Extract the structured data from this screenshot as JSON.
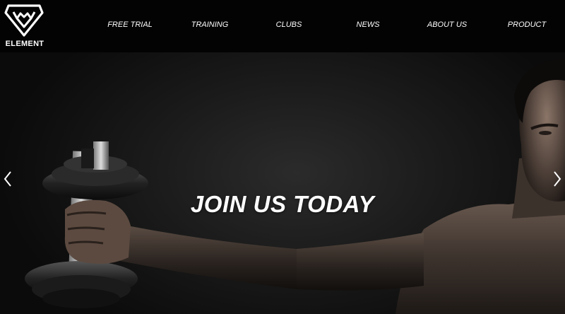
{
  "brand": {
    "name": "ELEMENT",
    "logo_icon": "bull-head-diamond-logo"
  },
  "nav": {
    "items": [
      {
        "label": "FREE TRIAL"
      },
      {
        "label": "TRAINING"
      },
      {
        "label": "CLUBS"
      },
      {
        "label": "NEWS"
      },
      {
        "label": "ABOUT US"
      },
      {
        "label": "PRODUCT"
      }
    ]
  },
  "hero": {
    "headline": "JOIN US TODAY",
    "prev_icon": "chevron-left-icon",
    "next_icon": "chevron-right-icon"
  },
  "colors": {
    "header_bg": "#030303",
    "text": "#ffffff",
    "hero_bg": "#1c1c1c"
  }
}
